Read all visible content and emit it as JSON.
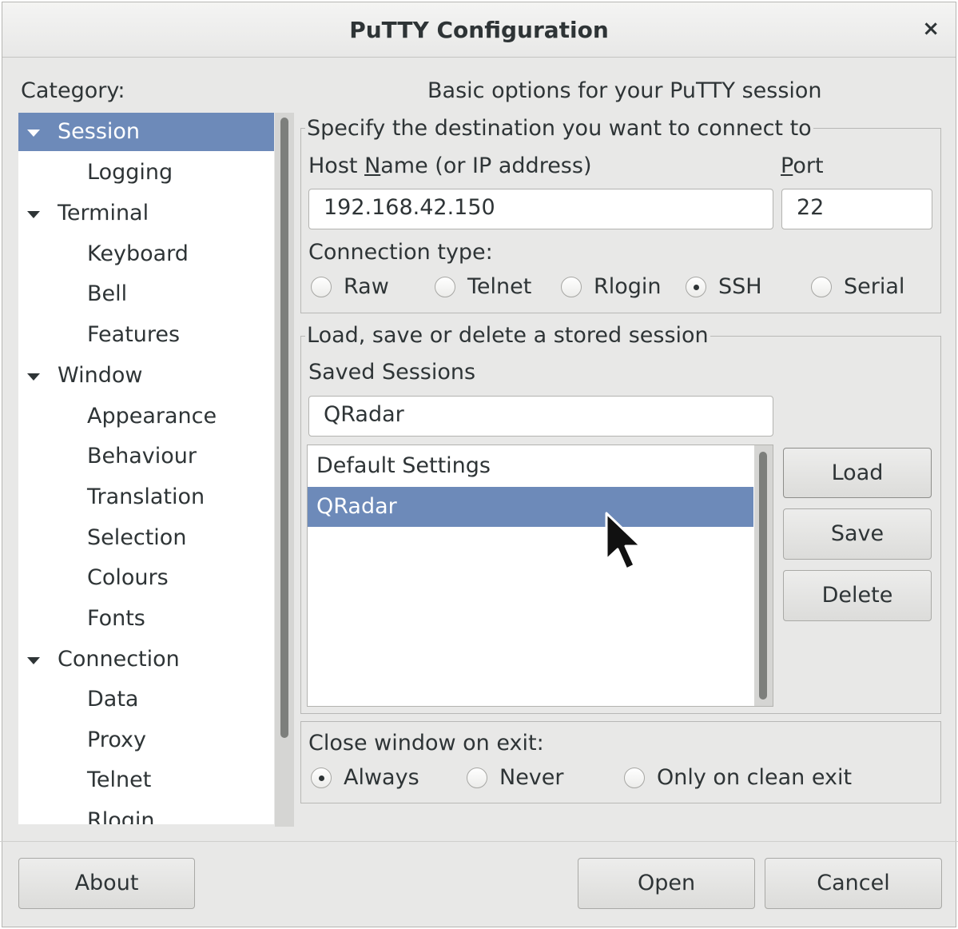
{
  "window": {
    "title": "PuTTY Configuration",
    "close_glyph": "×"
  },
  "category": {
    "label": "Category:",
    "items": [
      {
        "label": "Session",
        "level": 0,
        "expanded": true,
        "selected": true
      },
      {
        "label": "Logging",
        "level": 1
      },
      {
        "label": "Terminal",
        "level": 0,
        "expanded": true
      },
      {
        "label": "Keyboard",
        "level": 1
      },
      {
        "label": "Bell",
        "level": 1
      },
      {
        "label": "Features",
        "level": 1
      },
      {
        "label": "Window",
        "level": 0,
        "expanded": true
      },
      {
        "label": "Appearance",
        "level": 1
      },
      {
        "label": "Behaviour",
        "level": 1
      },
      {
        "label": "Translation",
        "level": 1
      },
      {
        "label": "Selection",
        "level": 1
      },
      {
        "label": "Colours",
        "level": 1
      },
      {
        "label": "Fonts",
        "level": 1
      },
      {
        "label": "Connection",
        "level": 0,
        "expanded": true
      },
      {
        "label": "Data",
        "level": 1
      },
      {
        "label": "Proxy",
        "level": 1
      },
      {
        "label": "Telnet",
        "level": 1
      },
      {
        "label": "Rlogin",
        "level": 1
      }
    ]
  },
  "panel": {
    "heading": "Basic options for your PuTTY session",
    "destination": {
      "legend": "Specify the destination you want to connect to",
      "host_label_pre": "Host ",
      "host_label_mnemonic": "N",
      "host_label_post": "ame (or IP address)",
      "host_value": "192.168.42.150",
      "port_label_mnemonic": "P",
      "port_label_post": "ort",
      "port_value": "22",
      "conn_type_label": "Connection type:",
      "conn_types": [
        {
          "label": "Raw",
          "checked": false
        },
        {
          "label": "Telnet",
          "checked": false
        },
        {
          "label": "Rlogin",
          "checked": false
        },
        {
          "label": "SSH",
          "checked": true
        },
        {
          "label": "Serial",
          "checked": false
        }
      ]
    },
    "sessions": {
      "legend": "Load, save or delete a stored session",
      "saved_label": "Saved Sessions",
      "saved_value": "QRadar",
      "list": [
        {
          "label": "Default Settings",
          "selected": false
        },
        {
          "label": "QRadar",
          "selected": true
        }
      ],
      "load_label": "Load",
      "save_label": "Save",
      "delete_label": "Delete"
    },
    "close_on_exit": {
      "label": "Close window on exit:",
      "options": [
        {
          "label": "Always",
          "checked": true
        },
        {
          "label": "Never",
          "checked": false
        },
        {
          "label": "Only on clean exit",
          "checked": false
        }
      ]
    }
  },
  "footer": {
    "about_label": "About",
    "open_label": "Open",
    "cancel_label": "Cancel"
  },
  "colors": {
    "selection": "#6d8ab9",
    "window_bg": "#e8e8e7"
  }
}
